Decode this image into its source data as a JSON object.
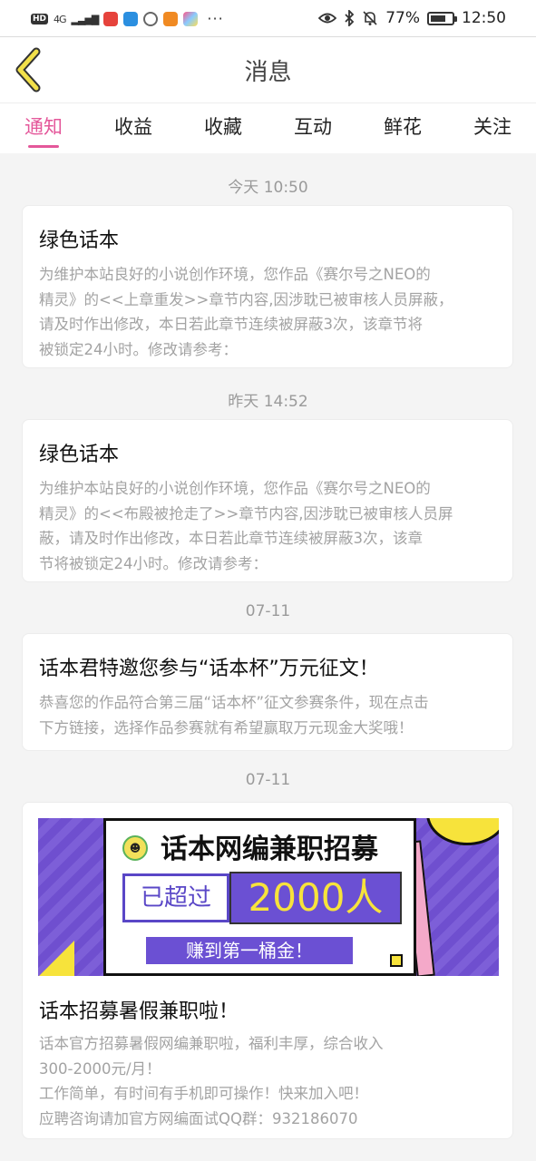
{
  "status_bar": {
    "hd": "HD",
    "network": "4G",
    "dots": "···",
    "battery_percent": "77%",
    "time": "12:50"
  },
  "header": {
    "title": "消息"
  },
  "tabs": [
    {
      "label": "通知",
      "active": true
    },
    {
      "label": "收益",
      "active": false
    },
    {
      "label": "收藏",
      "active": false
    },
    {
      "label": "互动",
      "active": false
    },
    {
      "label": "鲜花",
      "active": false
    },
    {
      "label": "关注",
      "active": false
    }
  ],
  "feed": [
    {
      "date": "今天 10:50",
      "title": "绿色话本",
      "body": "为维护本站良好的小说创作环境，您作品《赛尔号之NEO的\n精灵》的<<上章重发>>章节内容,因涉耽已被审核人员屏蔽，\n请及时作出修改，本日若此章节连续被屏蔽3次，该章节将\n被锁定24小时。修改请参考："
    },
    {
      "date": "昨天 14:52",
      "title": "绿色话本",
      "body": "为维护本站良好的小说创作环境，您作品《赛尔号之NEO的\n精灵》的<<布殿被抢走了>>章节内容,因涉耽已被审核人员屏\n蔽，请及时作出修改，本日若此章节连续被屏蔽3次，该章\n节将被锁定24小时。修改请参考："
    },
    {
      "date": "07-11",
      "title": "话本君特邀您参与“话本杯”万元征文！",
      "body": "恭喜您的作品符合第三届“话本杯”征文参赛条件，现在点击\n下方链接，选择作品参赛就有希望赢取万元现金大奖哦！"
    },
    {
      "date": "07-11",
      "banner": {
        "title": "话本网编兼职招募",
        "left_text": "已超过",
        "right_text": "2000人",
        "cta": "赚到第一桶金！"
      },
      "title": "话本招募暑假兼职啦！",
      "body": "话本官方招募暑假网编兼职啦，福利丰厚，综合收入\n300-2000元/月！\n工作简单，有时间有手机即可操作！快来加入吧！\n应聘咨询请加官方网编面试QQ群：932186070"
    }
  ],
  "colors": {
    "accent": "#e4579a",
    "back_arrow": "#f2e04a",
    "banner_purple": "#6b50d3",
    "banner_yellow": "#f7e33b"
  },
  "icons": {
    "back": "chevron-left-icon",
    "eye": "eye-icon",
    "bluetooth": "bluetooth-icon",
    "mute": "bell-off-icon",
    "battery": "battery-icon"
  }
}
